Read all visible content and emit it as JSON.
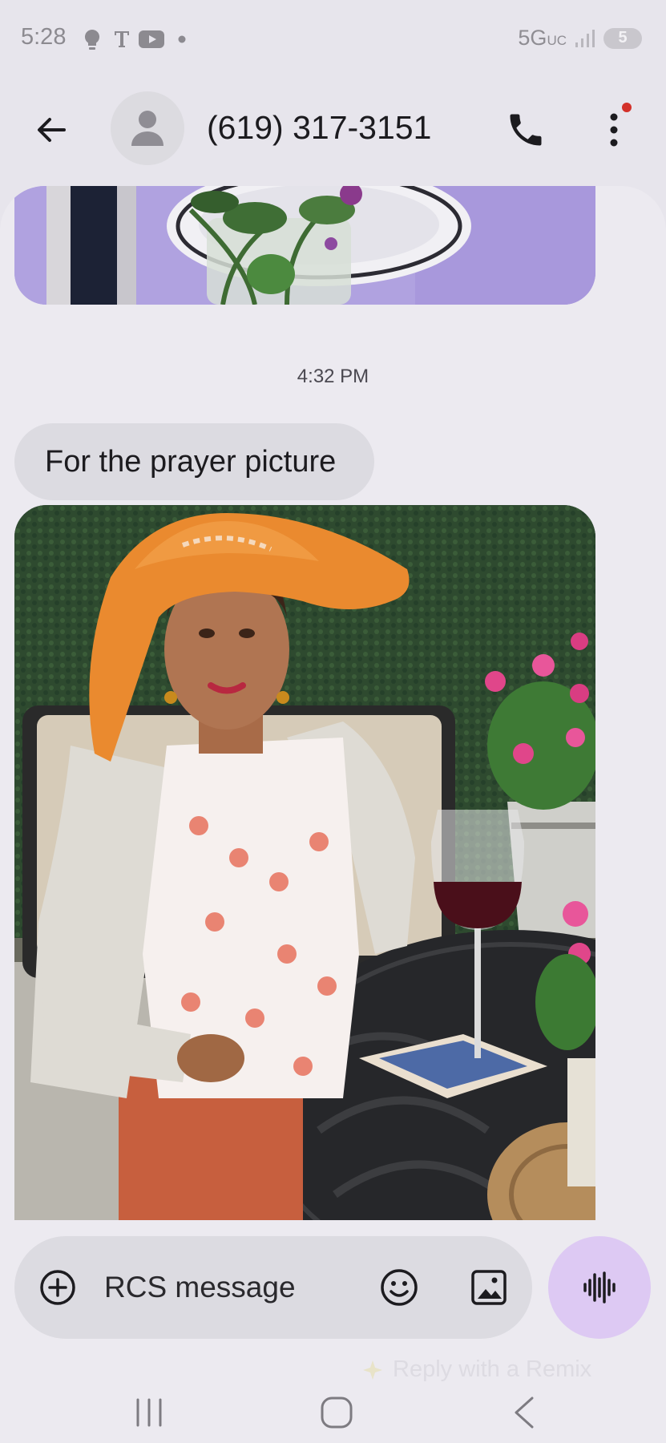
{
  "status_bar": {
    "time": "5:28",
    "network": "5G",
    "network_sub": "UC",
    "battery": "5"
  },
  "header": {
    "contact": "(619) 317-3151"
  },
  "conversation": {
    "timestamp": "4:32 PM",
    "message_text": "For the prayer picture"
  },
  "composer": {
    "placeholder": "RCS message"
  },
  "remix_hint": "Reply with a Remix",
  "icons": {
    "back": "arrow-left-icon",
    "call": "phone-icon",
    "more": "more-vert-icon",
    "add": "add-circle-icon",
    "emoji": "emoji-icon",
    "gallery": "image-icon",
    "voice": "waveform-icon"
  },
  "colors": {
    "background": "#e7e5ec",
    "bubble": "#dcdbe1",
    "voice_button": "#ddc9f3",
    "notification_dot": "#d3312a"
  }
}
